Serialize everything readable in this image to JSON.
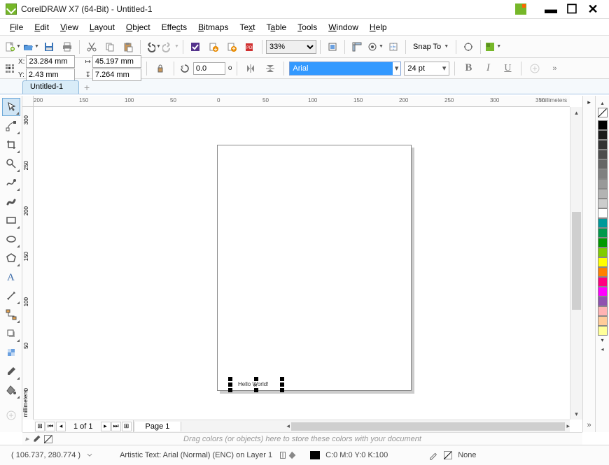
{
  "window": {
    "title": "CorelDRAW X7 (64-Bit) - Untitled-1"
  },
  "menu": [
    "File",
    "Edit",
    "View",
    "Layout",
    "Object",
    "Effects",
    "Bitmaps",
    "Text",
    "Table",
    "Tools",
    "Window",
    "Help"
  ],
  "toolbar1": {
    "zoom": "33%",
    "snap": "Snap To"
  },
  "propbar": {
    "x_label": "X:",
    "y_label": "Y:",
    "x": "23.284 mm",
    "y": "2.43 mm",
    "w": "45.197 mm",
    "h": "7.264 mm",
    "angle": "0.0",
    "angle_unit": "o",
    "font": "Arial",
    "fontsize": "24 pt"
  },
  "doctab": "Untitled-1",
  "ruler_unit": "millimeters",
  "ruler_h": [
    {
      "v": "200",
      "p": 0
    },
    {
      "v": "150",
      "p": 65
    },
    {
      "v": "100",
      "p": 130
    },
    {
      "v": "50",
      "p": 195
    },
    {
      "v": "0",
      "p": 262
    },
    {
      "v": "50",
      "p": 327
    },
    {
      "v": "100",
      "p": 392
    },
    {
      "v": "150",
      "p": 457
    },
    {
      "v": "200",
      "p": 522
    },
    {
      "v": "250",
      "p": 587
    },
    {
      "v": "300",
      "p": 652
    },
    {
      "v": "350",
      "p": 717
    }
  ],
  "ruler_v": [
    {
      "v": "300",
      "p": 12
    },
    {
      "v": "250",
      "p": 77
    },
    {
      "v": "200",
      "p": 142
    },
    {
      "v": "150",
      "p": 207
    },
    {
      "v": "100",
      "p": 272
    },
    {
      "v": "50",
      "p": 337
    },
    {
      "v": "0",
      "p": 402
    }
  ],
  "canvas_text": "Hello World!",
  "pagenav": {
    "count": "1 of 1",
    "pagetab": "Page 1"
  },
  "palette_hint": "Drag colors (or objects) here to store these colors with your document",
  "statusbar": {
    "coords": "( 106.737, 280.774 )",
    "info": "Artistic Text: Arial (Normal) (ENC) on Layer 1",
    "fill": "C:0 M:0 Y:0 K:100",
    "outline": "None"
  },
  "palette_colors": [
    "#000000",
    "#1a1a1a",
    "#333333",
    "#4d4d4d",
    "#666666",
    "#808080",
    "#999999",
    "#b3b3b3",
    "#cccccc",
    "#ffffff",
    "#009999",
    "#00994c",
    "#009900",
    "#80cc00",
    "#ffff00",
    "#ff8000",
    "#ff0080",
    "#ff00ff",
    "#8f52b0",
    "#ffb3b3",
    "#ffcc99",
    "#ffff99"
  ]
}
